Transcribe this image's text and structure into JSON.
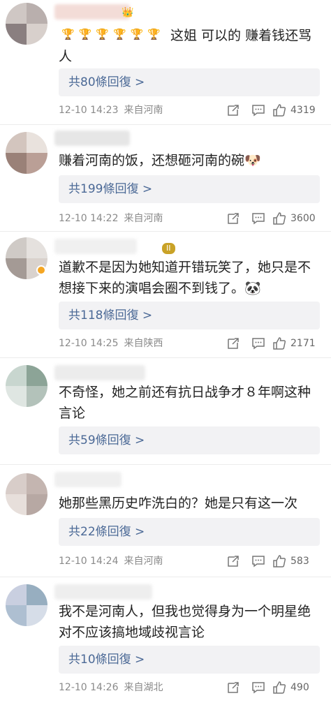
{
  "comments": [
    {
      "badges": "🏆🏆🏆🏆🏆🏆",
      "text": "这姐 可以的 赚着钱还骂人",
      "replies": "共80條回復 >",
      "time": "12-10 14:23",
      "location": "来自河南",
      "likes": "4319"
    },
    {
      "text": "赚着河南的饭，还想砸河南的碗🐶",
      "replies": "共199條回復 >",
      "time": "12-10 14:22",
      "location": "来自河南",
      "likes": "3600"
    },
    {
      "badge": "II",
      "text": "道歉不是因为她知道开错玩笑了，她只是不想接下来的演唱会圈不到钱了。🐼",
      "replies": "共118條回復 >",
      "time": "12-10 14:25",
      "location": "来自陕西",
      "likes": "2171"
    },
    {
      "text": "不奇怪，她之前还有抗日战争才８年啊这种言论",
      "replies": "共59條回復 >",
      "time": "",
      "location": "",
      "likes": ""
    },
    {
      "text": "她那些黑历史咋洗白的？她是只有这一次吗？",
      "replies": "共22條回復 >",
      "time": "12-10 14:24",
      "location": "来自河南",
      "likes": "583"
    },
    {
      "text": "我不是河南人，但我也觉得身为一个明星绝对不应该搞地域歧视言论",
      "replies": "共10條回復 >",
      "time": "12-10 14:26",
      "location": "来自湖北",
      "likes": "490"
    }
  ],
  "icons": {
    "share": "share-icon",
    "comment": "comment-icon",
    "like": "thumbs-up-icon"
  }
}
